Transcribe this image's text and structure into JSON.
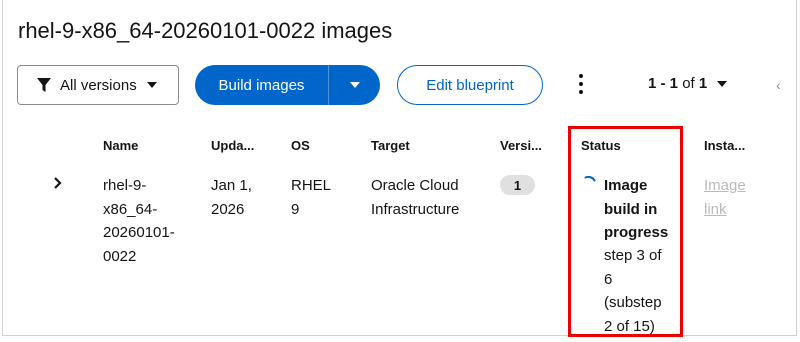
{
  "page": {
    "title": "rhel-9-x86_64-20260101-0022 images"
  },
  "toolbar": {
    "version_filter_label": "All versions",
    "build_label": "Build images",
    "edit_label": "Edit blueprint",
    "pagination_range": "1 - 1",
    "pagination_of": "of",
    "pagination_total": "1"
  },
  "table": {
    "headers": {
      "name": "Name",
      "updated": "Upda...",
      "os": "OS",
      "target": "Target",
      "version": "Versi...",
      "status": "Status",
      "instance": "Insta..."
    },
    "rows": [
      {
        "name_lines": [
          "rhel-9-",
          "x86_64-",
          "20260101-",
          "0022"
        ],
        "updated_lines": [
          "Jan 1,",
          "2026"
        ],
        "os_lines": [
          "RHEL",
          "9"
        ],
        "target_lines": [
          "Oracle Cloud",
          "Infrastructure"
        ],
        "version": "1",
        "status_lines": [
          "Image",
          "build in",
          "progress"
        ],
        "status_detail_lines": [
          "step 3 of",
          "6",
          "(substep",
          "2 of 15)"
        ],
        "instance_lines": [
          "Image",
          "link"
        ]
      }
    ]
  },
  "colors": {
    "primary": "#0066cc",
    "highlight": "#ee0000",
    "disabled_link": "#b8bbbe"
  }
}
